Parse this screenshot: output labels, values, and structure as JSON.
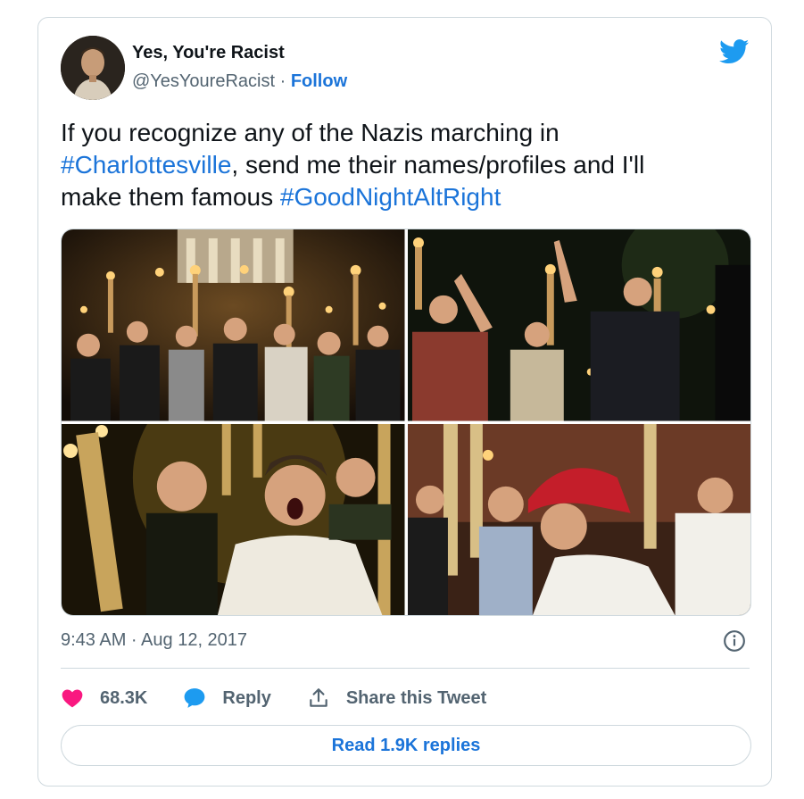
{
  "tweet": {
    "author_name": "Yes, You're Racist",
    "author_handle": "@YesYoureRacist",
    "separator": " · ",
    "follow_label": "Follow",
    "text_line1_pre": "If you recognize any of the Nazis marching in",
    "hashtag1": "#Charlottesville",
    "text_line2_post": ", send me their names/profiles and I'll",
    "text_line3_pre": "make them famous ",
    "hashtag2": "#GoodNightAltRight",
    "timestamp": "9:43 AM · Aug 12, 2017"
  },
  "actions": {
    "like_count": "68.3K",
    "reply_label": "Reply",
    "share_label": "Share this Tweet"
  },
  "footer": {
    "read_replies_label": "Read 1.9K replies"
  },
  "icons": {
    "brand": "twitter-bird-icon",
    "like": "heart-icon",
    "reply": "speech-bubble-icon",
    "share": "share-upload-icon",
    "info": "info-icon"
  },
  "colors": {
    "accent": "#1b74d9",
    "twitter_blue": "#1d9bf0",
    "heart": "#f91880",
    "muted": "#536471",
    "border": "#cfd9de"
  }
}
